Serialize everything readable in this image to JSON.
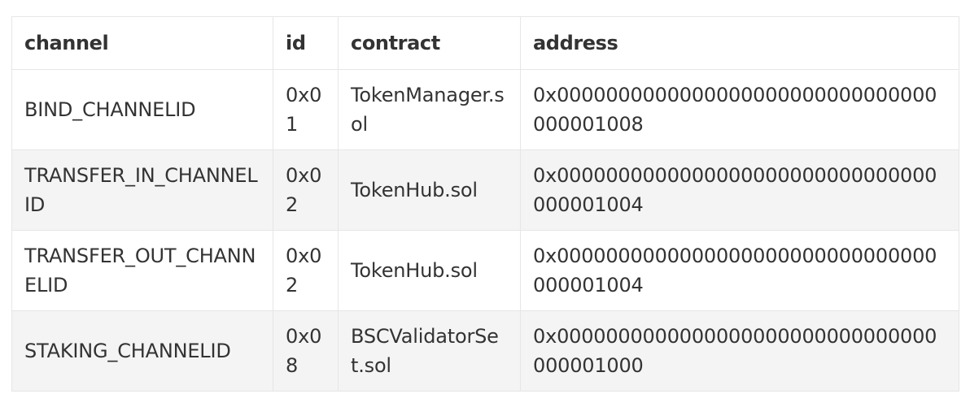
{
  "table": {
    "headers": [
      "channel",
      "id",
      "contract",
      "address"
    ],
    "rows": [
      {
        "channel": "BIND_CHANNELID",
        "id": "0x01",
        "contract": "TokenManager.sol",
        "address": "0x0000000000000000000000000000000000001008"
      },
      {
        "channel": "TRANSFER_IN_CHANNELID",
        "id": "0x02",
        "contract": "TokenHub.sol",
        "address": "0x0000000000000000000000000000000000001004"
      },
      {
        "channel": "TRANSFER_OUT_CHANNELID",
        "id": "0x02",
        "contract": "TokenHub.sol",
        "address": "0x0000000000000000000000000000000000001004"
      },
      {
        "channel": "STAKING_CHANNELID",
        "id": "0x08",
        "contract": "BSCValidatorSet.sol",
        "address": "0x0000000000000000000000000000000000001000"
      }
    ]
  }
}
